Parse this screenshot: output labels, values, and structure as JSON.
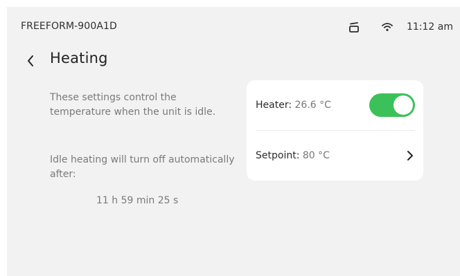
{
  "status_bar": {
    "device_name": "FREEFORM-900A1D",
    "icons": [
      "cup-icon",
      "wifi-icon"
    ],
    "time": "11:12 am"
  },
  "header": {
    "title": "Heating",
    "back_icon": "chevron-left-icon"
  },
  "info": {
    "description": "These settings control the temperature when the unit is idle.",
    "auto_off_text": "Idle heating will turn off automatically after:",
    "countdown": "11 h 59 min 25 s"
  },
  "settings": {
    "heater": {
      "label": "Heater:",
      "value": "26.6 °C",
      "toggle_on": true,
      "toggle_color": "#3cc15a"
    },
    "setpoint": {
      "label": "Setpoint:",
      "value": "80 °C",
      "chevron_icon": "chevron-right-icon"
    }
  }
}
